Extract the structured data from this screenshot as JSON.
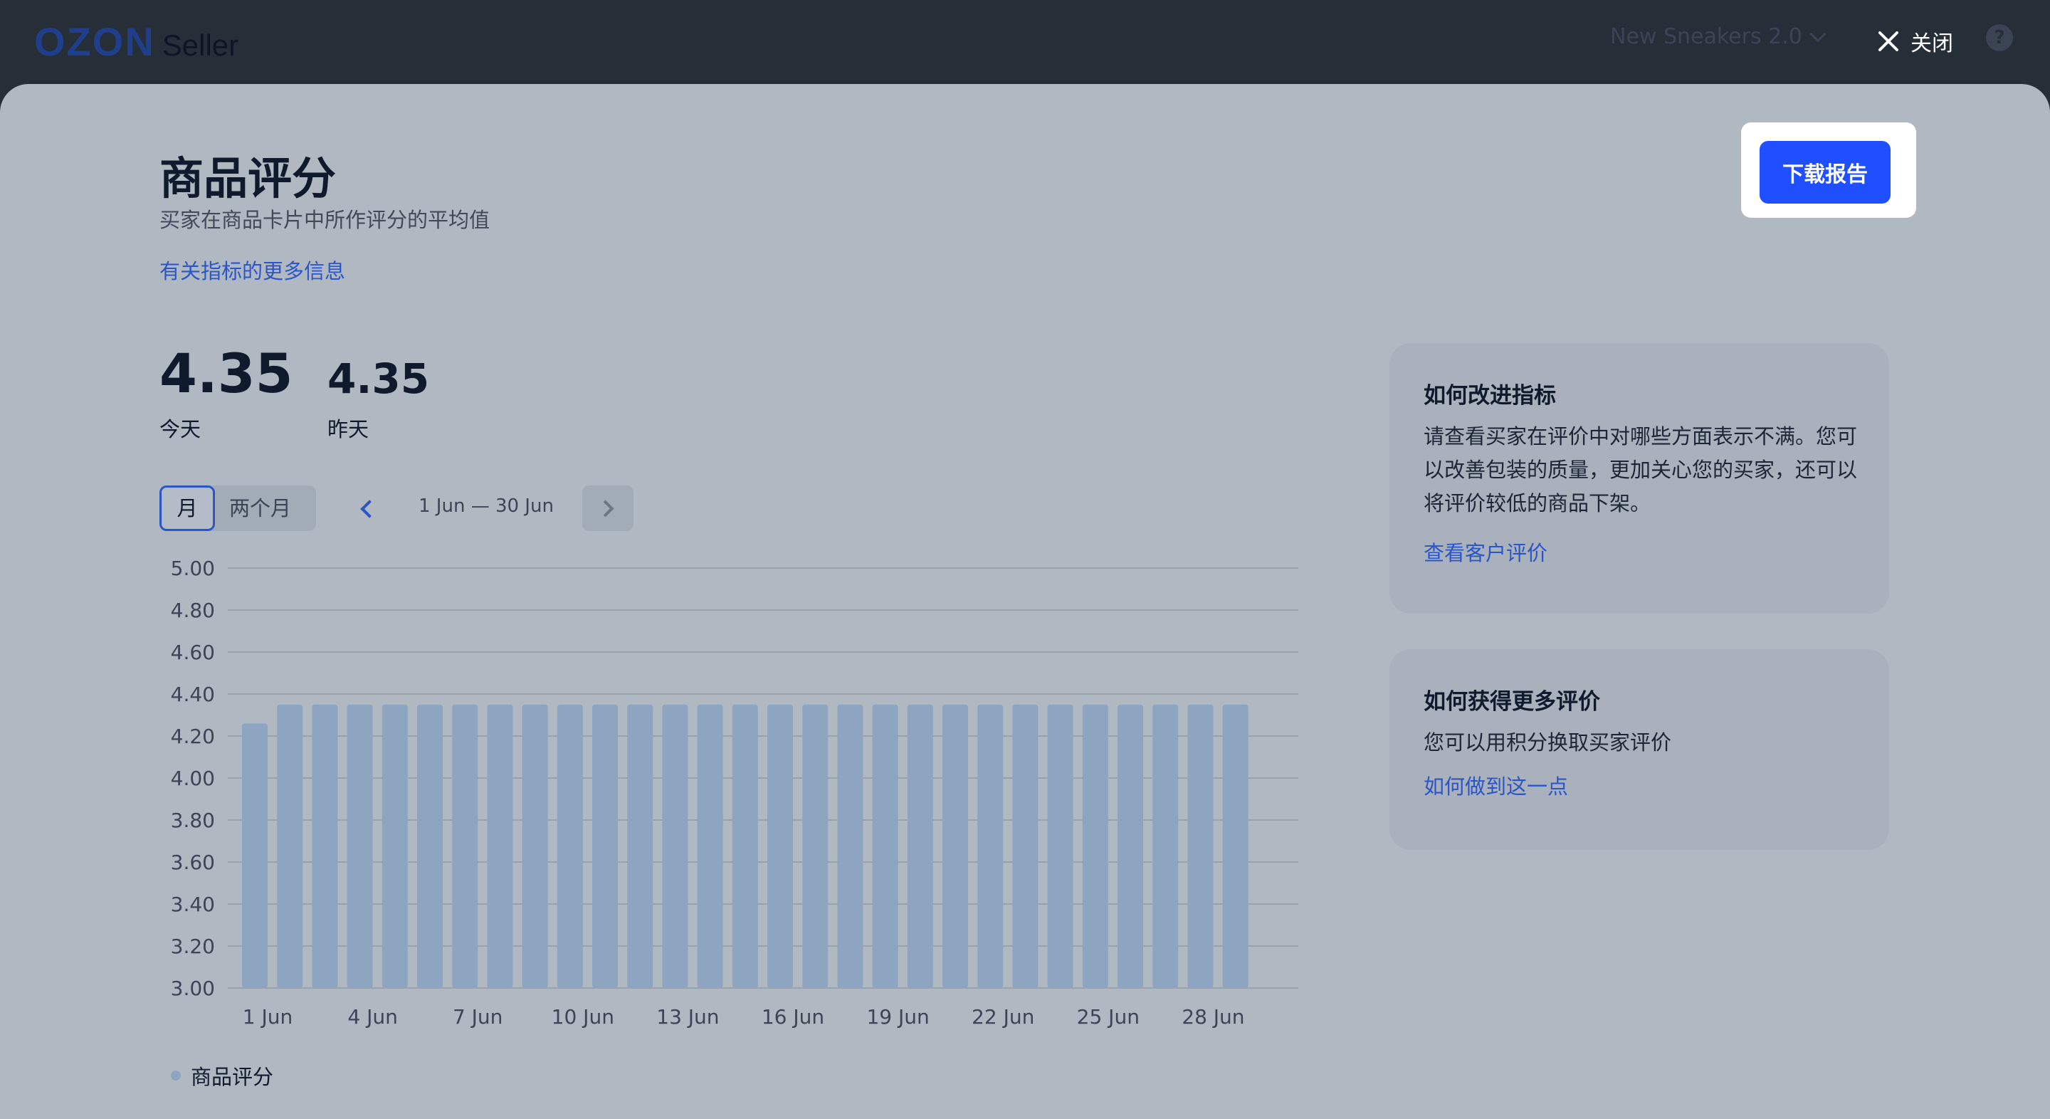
{
  "header": {
    "logo_primary": "OZON",
    "logo_secondary": "Seller",
    "store_name": "New Sneakers 2.0",
    "close_label": "关闭",
    "help_label": "?"
  },
  "page": {
    "title": "商品评分",
    "subtitle": "买家在商品卡片中所作评分的平均值",
    "more_link": "有关指标的更多信息",
    "download_label": "下载报告"
  },
  "metrics": {
    "today_value": "4.35",
    "today_label": "今天",
    "yesterday_value": "4.35",
    "yesterday_label": "昨天"
  },
  "period": {
    "month_label": "月",
    "two_months_label": "两个月",
    "range": "1 Jun — 30 Jun"
  },
  "chart_data": {
    "type": "bar",
    "categories": [
      "1 Jun",
      "2 Jun",
      "3 Jun",
      "4 Jun",
      "5 Jun",
      "6 Jun",
      "7 Jun",
      "8 Jun",
      "9 Jun",
      "10 Jun",
      "11 Jun",
      "12 Jun",
      "13 Jun",
      "14 Jun",
      "15 Jun",
      "16 Jun",
      "17 Jun",
      "18 Jun",
      "19 Jun",
      "20 Jun",
      "21 Jun",
      "22 Jun",
      "23 Jun",
      "24 Jun",
      "25 Jun",
      "26 Jun",
      "27 Jun",
      "28 Jun",
      "29 Jun"
    ],
    "series": [
      {
        "name": "商品评分",
        "values": [
          4.26,
          4.35,
          4.35,
          4.35,
          4.35,
          4.35,
          4.35,
          4.35,
          4.35,
          4.35,
          4.35,
          4.35,
          4.35,
          4.35,
          4.35,
          4.35,
          4.35,
          4.35,
          4.35,
          4.35,
          4.35,
          4.35,
          4.35,
          4.35,
          4.35,
          4.35,
          4.35,
          4.35,
          4.35
        ]
      }
    ],
    "x_tick_labels": [
      "1 Jun",
      "4 Jun",
      "7 Jun",
      "10 Jun",
      "13 Jun",
      "16 Jun",
      "19 Jun",
      "22 Jun",
      "25 Jun",
      "28 Jun"
    ],
    "y_ticks": [
      "5.00",
      "4.80",
      "4.60",
      "4.40",
      "4.20",
      "4.00",
      "3.80",
      "3.60",
      "3.40",
      "3.20",
      "3.00"
    ],
    "ylim": [
      3.0,
      5.0
    ],
    "grid": true,
    "legend_position": "bottom-left",
    "bar_color": "#8ea5c1",
    "grid_color": "#97a2ae"
  },
  "cards": [
    {
      "title": "如何改进指标",
      "body": "请查看买家在评价中对哪些方面表示不满。您可以改善包装的质量，更加关心您的买家，还可以将评价较低的商品下架。",
      "link": "查看客户评价"
    },
    {
      "title": "如何获得更多评价",
      "body": "您可以用积分换取买家评价",
      "link": "如何做到这一点"
    }
  ]
}
